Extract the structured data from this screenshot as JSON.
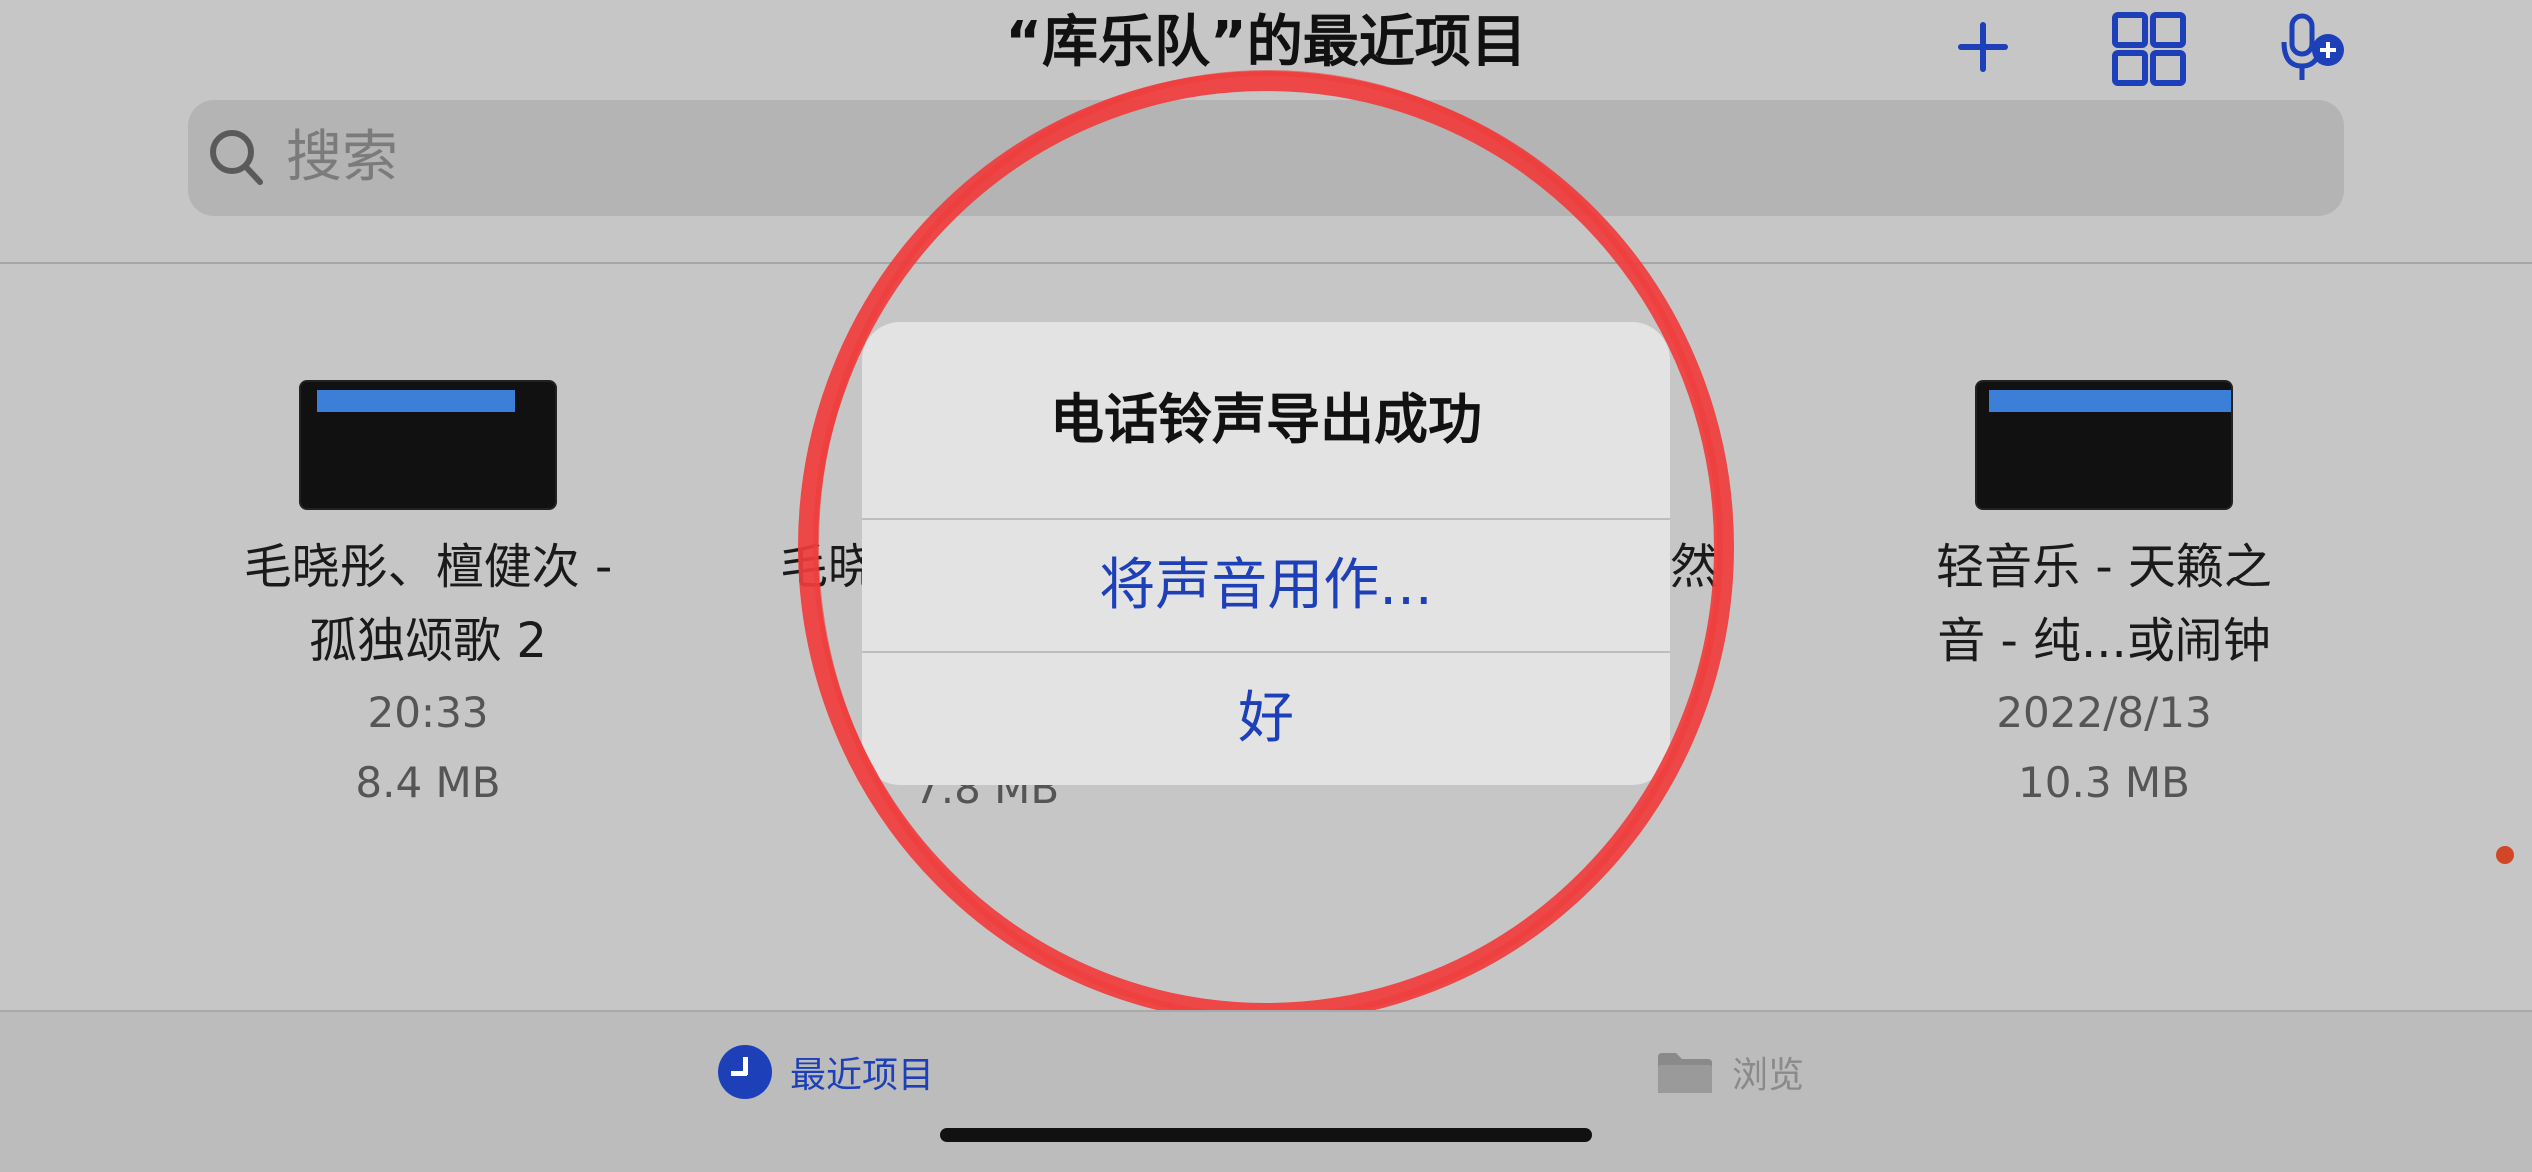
{
  "header": {
    "title": "“库乐队”的最近项目",
    "actions": [
      {
        "name": "plus-icon"
      },
      {
        "name": "grid-view-icon"
      },
      {
        "name": "mic-add-icon"
      }
    ]
  },
  "search": {
    "placeholder": "搜索",
    "icon": "search-icon"
  },
  "files": [
    {
      "name_line1": "毛晓彤、檀健次 -",
      "name_line2": "孤独颂歌  2",
      "time": "20:33",
      "size": "8.4 MB"
    },
    {
      "name_line1": "毛晓",
      "name_line2": "",
      "time": "",
      "size": "7.8 MB"
    },
    {
      "name_line1": "然",
      "name_line2": "",
      "time": "",
      "size": ""
    },
    {
      "name_line1": "轻音乐 - 天籁之",
      "name_line2": "音 - 纯...或闹钟",
      "time": "2022/8/13",
      "size": "10.3 MB"
    }
  ],
  "dialog": {
    "title": "电话铃声导出成功",
    "buttons": [
      "将声音用作...",
      "好"
    ]
  },
  "tabbar": {
    "recent": {
      "label": "最近项目",
      "icon": "clock-icon"
    },
    "browse": {
      "label": "浏览",
      "icon": "folder-icon"
    }
  },
  "colors": {
    "accent": "#1d3fb8",
    "annotation": "#f03c3c",
    "background": "#c6c6c6"
  }
}
